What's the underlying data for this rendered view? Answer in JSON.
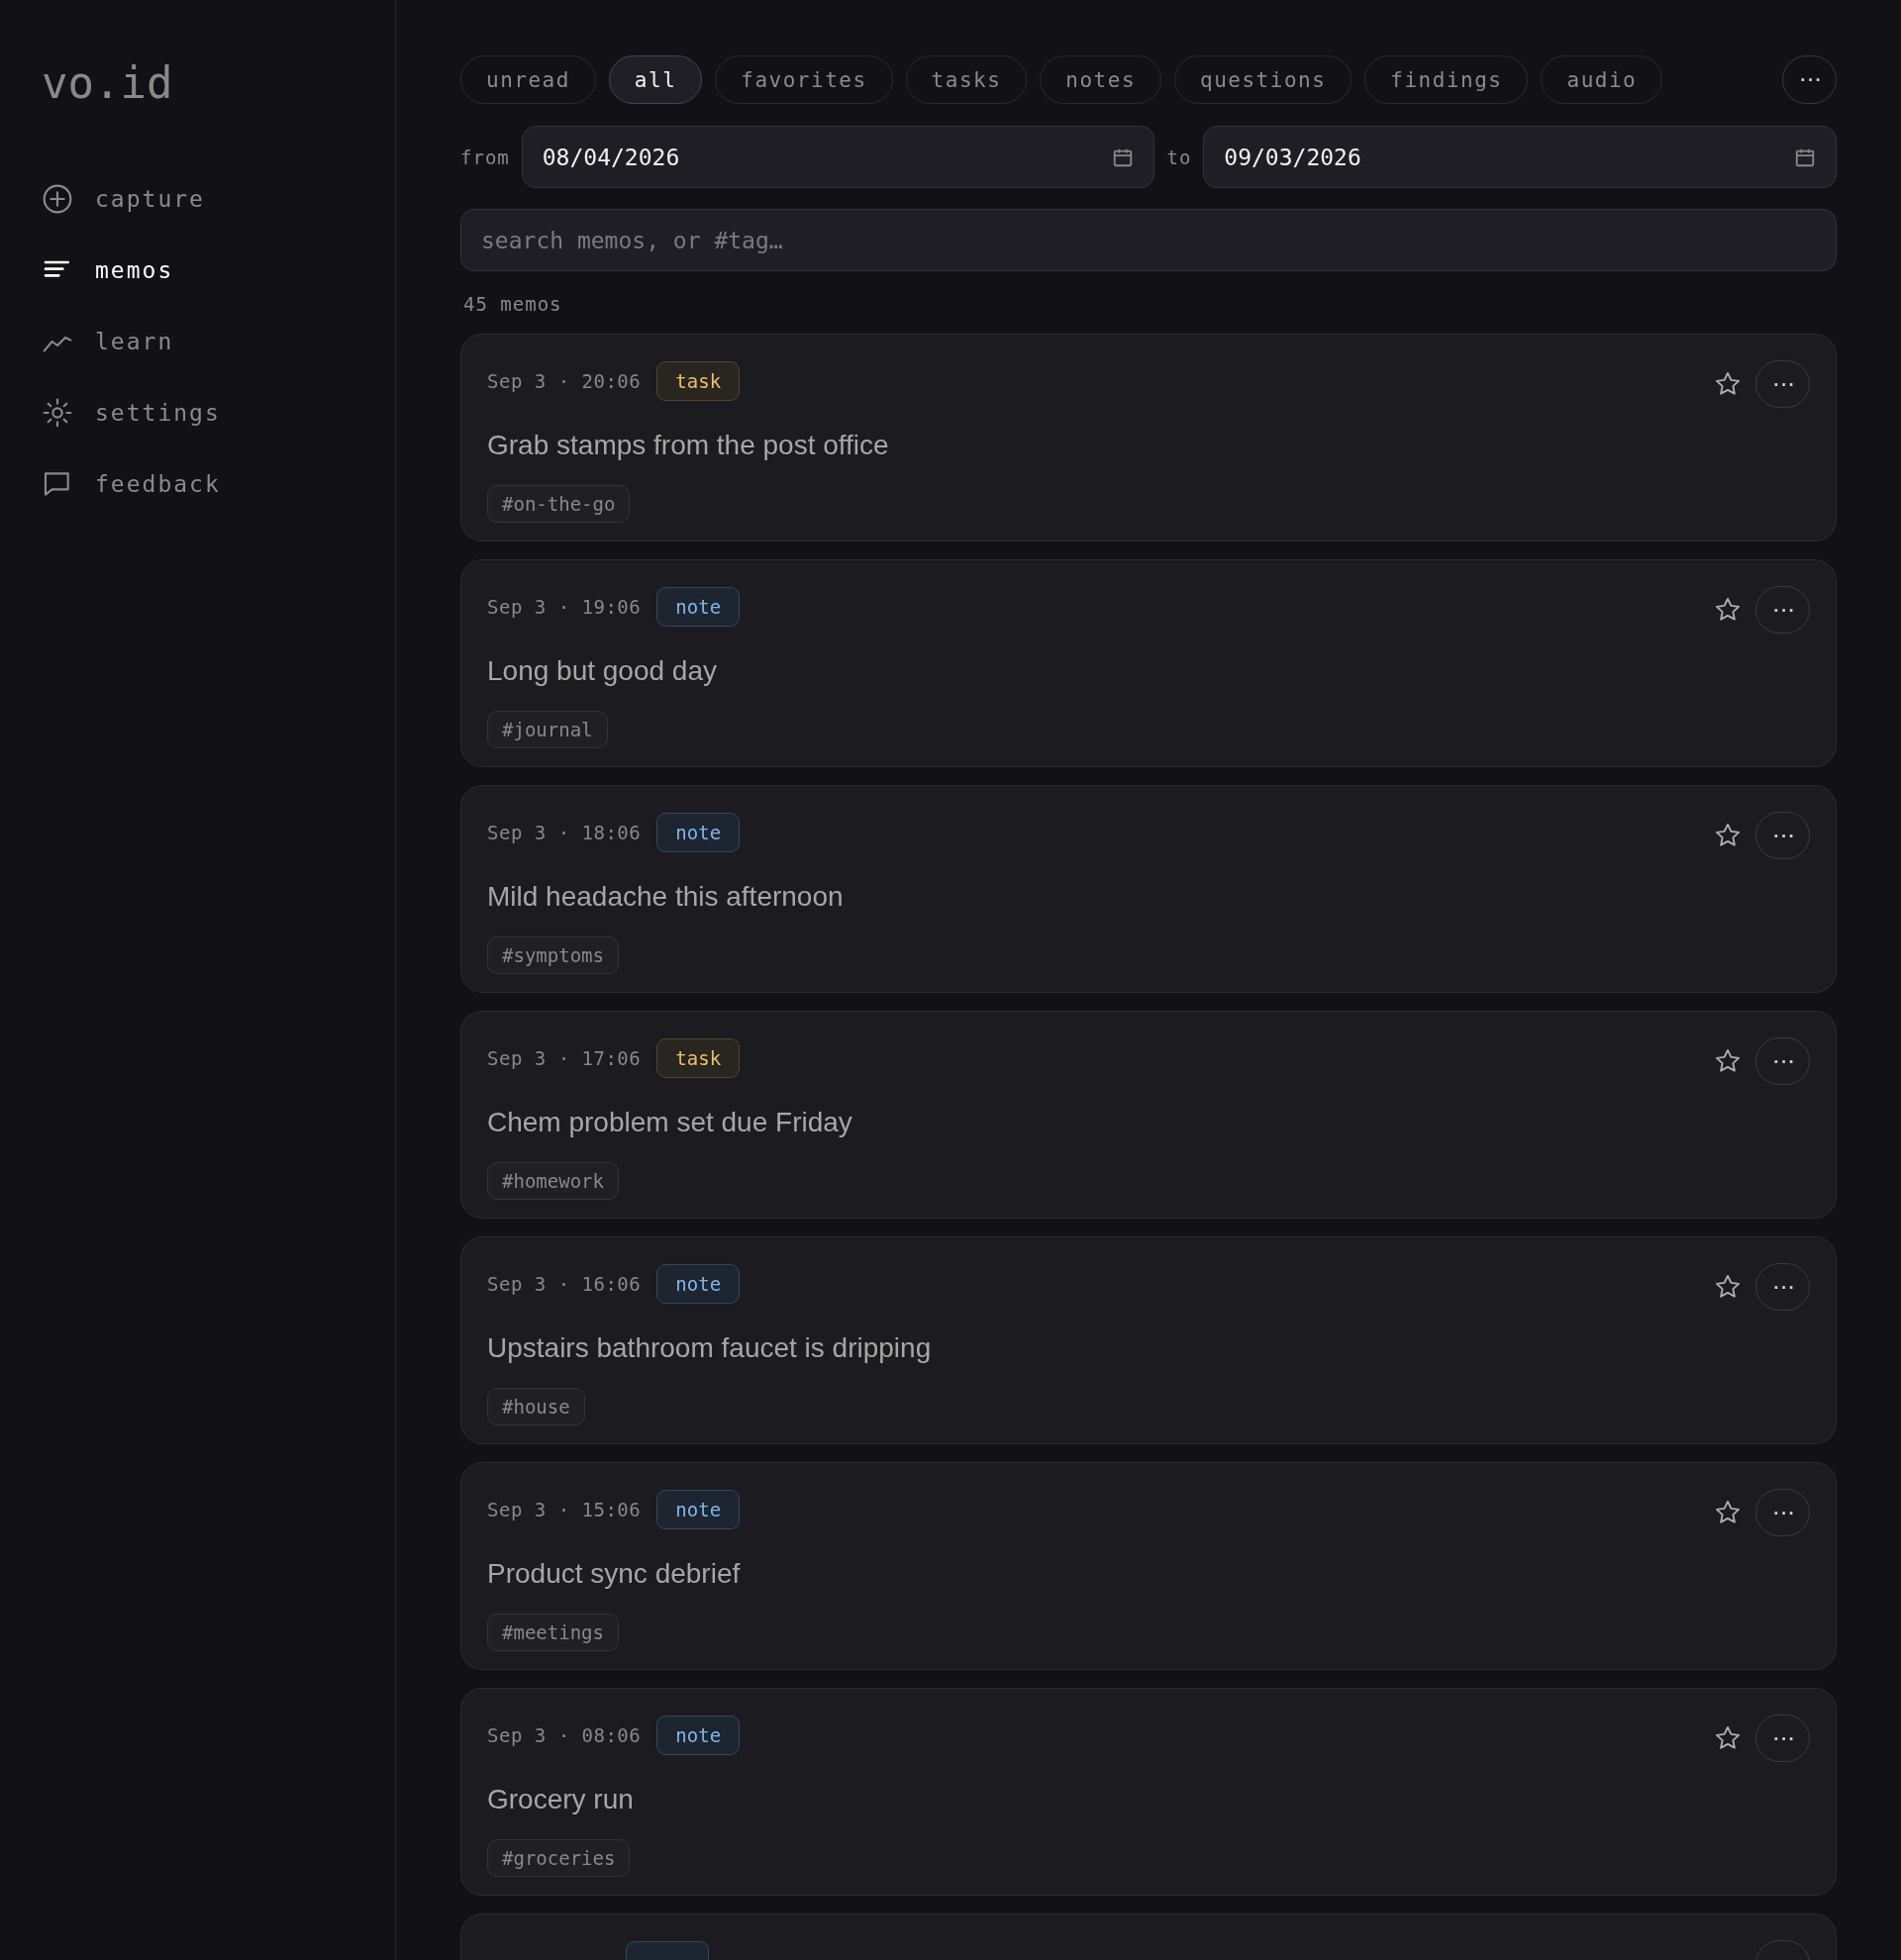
{
  "sidebar": {
    "logo": "vo.id",
    "items": [
      {
        "label": "capture",
        "selected": false
      },
      {
        "label": "memos",
        "selected": true
      },
      {
        "label": "learn",
        "selected": false
      },
      {
        "label": "settings",
        "selected": false
      },
      {
        "label": "feedback",
        "selected": false
      }
    ]
  },
  "filters": [
    {
      "label": "unread",
      "selected": false
    },
    {
      "label": "all",
      "selected": true
    },
    {
      "label": "favorites",
      "selected": false
    },
    {
      "label": "tasks",
      "selected": false
    },
    {
      "label": "notes",
      "selected": false
    },
    {
      "label": "questions",
      "selected": false
    },
    {
      "label": "findings",
      "selected": false
    },
    {
      "label": "audio",
      "selected": false
    }
  ],
  "more_button": "···",
  "date_range": {
    "from_label": "from",
    "from": "08/04/2026",
    "to_label": "to",
    "to": "09/03/2026"
  },
  "search": {
    "placeholder": "search memos, or #tag…"
  },
  "count": "45 memos",
  "memos": [
    {
      "time": "Sep 3 · 20:06",
      "kind": "task",
      "badge": "task",
      "text": "Grab stamps from the post office",
      "tag": "#on-the-go",
      "favorite": false,
      "more": "···"
    },
    {
      "time": "Sep 3 · 19:06",
      "kind": "note",
      "badge": "note",
      "text": "Long but good day",
      "tag": "#journal",
      "favorite": false,
      "more": "···"
    },
    {
      "time": "Sep 3 · 18:06",
      "kind": "note",
      "badge": "note",
      "text": "Mild headache this afternoon",
      "tag": "#symptoms",
      "favorite": false,
      "more": "···"
    },
    {
      "time": "Sep 3 · 17:06",
      "kind": "task",
      "badge": "task",
      "text": "Chem problem set due Friday",
      "tag": "#homework",
      "favorite": false,
      "more": "···"
    },
    {
      "time": "Sep 3 · 16:06",
      "kind": "note",
      "badge": "note",
      "text": "Upstairs bathroom faucet is dripping",
      "tag": "#house",
      "favorite": false,
      "more": "···"
    },
    {
      "time": "Sep 3 · 15:06",
      "kind": "note",
      "badge": "note",
      "text": "Product sync debrief",
      "tag": "#meetings",
      "favorite": false,
      "more": "···"
    },
    {
      "time": "Sep 3 · 08:06",
      "kind": "note",
      "badge": "note",
      "text": "Grocery run",
      "tag": "#groceries",
      "favorite": false,
      "more": "···"
    },
    {
      "kind": "note"
    }
  ]
}
